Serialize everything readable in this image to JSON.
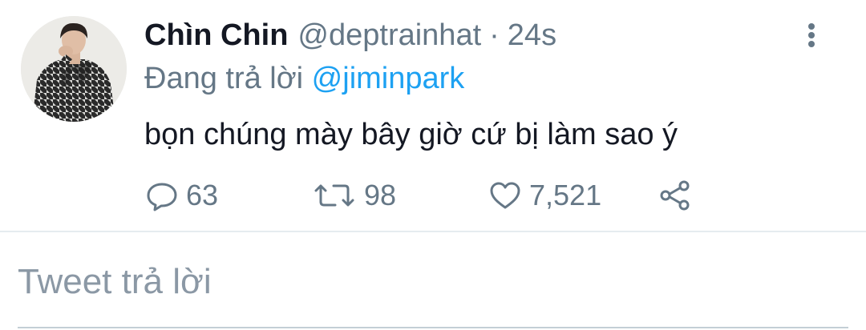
{
  "tweet": {
    "display_name": "Chìn Chin",
    "handle": "@deptrainhat",
    "separator": "·",
    "time": "24s",
    "replying_prefix": "Đang trả lời",
    "replying_to": "@jiminpark",
    "text": "bọn chúng mày bây giờ cứ bị làm sao ý",
    "counts": {
      "replies": "63",
      "retweets": "98",
      "likes": "7,521"
    },
    "icons": {
      "more": "more-vertical-icon",
      "reply": "reply-icon",
      "retweet": "retweet-icon",
      "like": "heart-icon",
      "share": "share-icon"
    }
  },
  "reply_composer": {
    "placeholder": "Tweet trả lời",
    "value": ""
  },
  "colors": {
    "text_primary": "#141823",
    "text_secondary": "#657786",
    "mention": "#1da1f2",
    "divider": "#e6ecf0",
    "placeholder": "#8b98a5"
  }
}
